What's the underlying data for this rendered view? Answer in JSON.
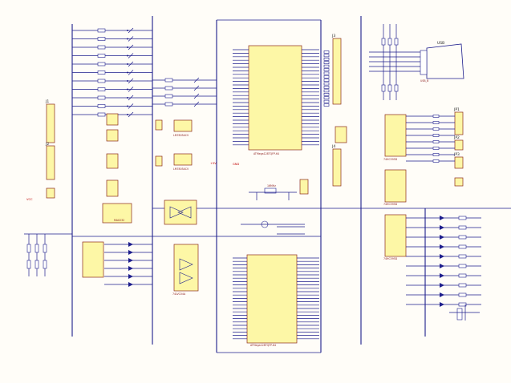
{
  "diagram": {
    "title": "",
    "rails": {
      "vcc": "VCC",
      "gnd": "GND",
      "p5v": "+5V"
    },
    "chips": {
      "u_top": "ATMega128TQFP-64",
      "u_bottom": "ATMega128TQFP-64",
      "reg1": "LM7805ACV",
      "reg2": "LM7805ACV",
      "max232": "MAX232",
      "buf1": "74LVC04A",
      "hc595a": "74HC595D",
      "hc595b": "74HC595D",
      "hc595c": "74HC595D",
      "usb": "USB"
    },
    "connectors": {
      "j1": "J1",
      "j2": "J2",
      "j3": "J3",
      "j4": "J4",
      "jp1": "JP1",
      "jp2": "JP2",
      "jp3": "JP3"
    },
    "parts": {
      "osc": "16MHz",
      "usb_part": "USB_B"
    }
  },
  "colors": {
    "wire": "#1d1d8c",
    "chip_fill": "#fdf7a6",
    "chip_border": "#8a2a1a",
    "rail_text": "#c00000",
    "background": "#fffdf8"
  }
}
